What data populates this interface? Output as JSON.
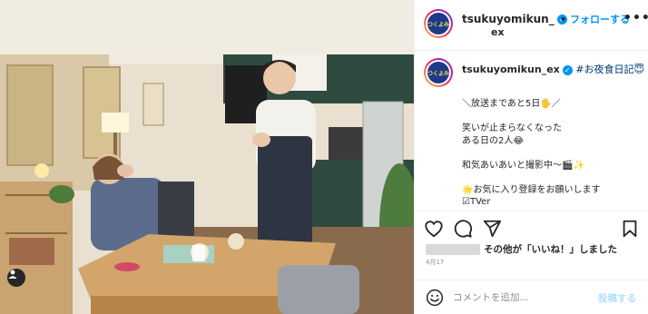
{
  "post": {
    "image_alt": "",
    "header": {
      "username_line1": "tsukuyomikun_",
      "username_line2": "ex",
      "follow_label": "フォローする",
      "separator": "•",
      "more_glyph": "•••"
    },
    "caption": {
      "username": "tsukuyomikun_ex",
      "hashtag_line": "#お夜食日記😇",
      "lines": [
        "＼放送まであと5日🖐／",
        "",
        "笑いが止まらなくなった",
        "ある日の2人😂",
        "",
        "和気あいあいと撮影中～🎬✨",
        "",
        "🌟お気に入り登録をお願いします",
        "☑TVer"
      ]
    },
    "likes": {
      "text_suffix": "その他が「いいね！」しました",
      "bold_part": "その他"
    },
    "date": "4月17",
    "comment": {
      "placeholder": "コメントを追加...",
      "post_label": "投稿する"
    },
    "avatar_text": "つくよみ",
    "colors": {
      "accent": "#0095f6",
      "post_disabled": "#b2dffc",
      "avatar_bg": "#1d3a8a"
    },
    "icons": [
      "heart-icon",
      "comment-icon",
      "share-icon",
      "bookmark-icon",
      "emoji-icon",
      "user-tag-icon",
      "verified-icon"
    ]
  }
}
